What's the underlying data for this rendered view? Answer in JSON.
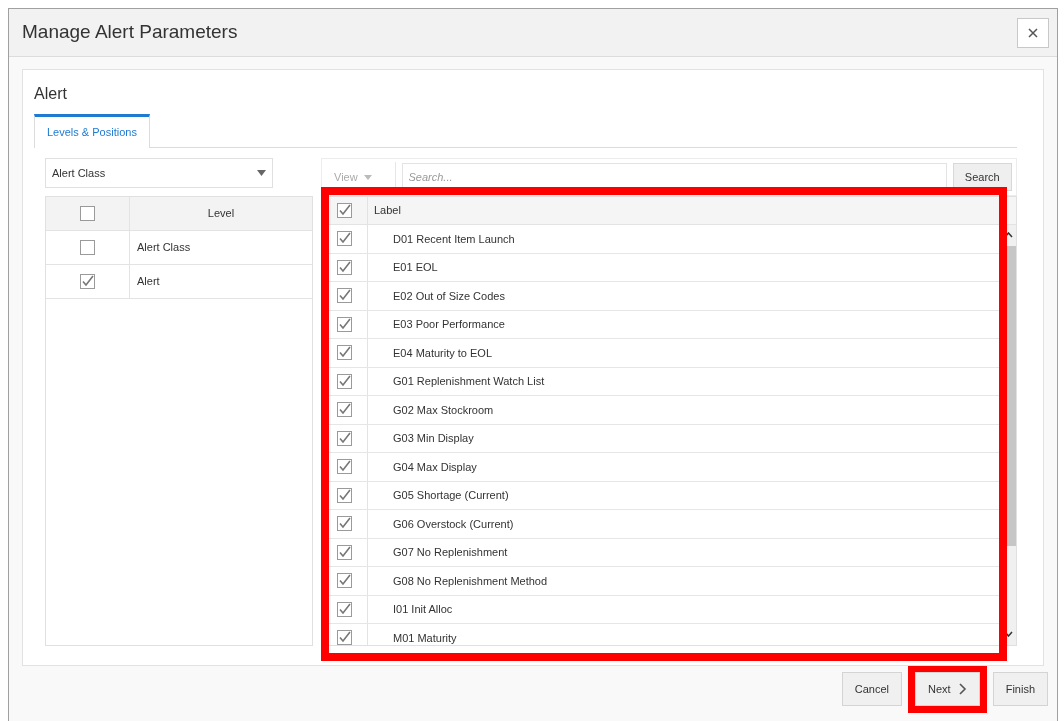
{
  "window": {
    "title": "Manage Alert Parameters"
  },
  "section_title": "Alert",
  "tabs": [
    {
      "label": "Levels & Positions",
      "selected": true
    }
  ],
  "level_select": {
    "value": "Alert Class"
  },
  "levels_table": {
    "header_checked": false,
    "column": "Level",
    "rows": [
      {
        "label": "Alert Class",
        "checked": false
      },
      {
        "label": "Alert",
        "checked": true
      }
    ]
  },
  "toolbar": {
    "view": "View",
    "search_placeholder": "Search...",
    "search_button": "Search"
  },
  "labels_table": {
    "header_checked": true,
    "column": "Label",
    "rows": [
      {
        "label": "D01 Recent Item Launch",
        "checked": true
      },
      {
        "label": "E01 EOL",
        "checked": true
      },
      {
        "label": "E02 Out of Size Codes",
        "checked": true
      },
      {
        "label": "E03 Poor Performance",
        "checked": true
      },
      {
        "label": "E04 Maturity to EOL",
        "checked": true
      },
      {
        "label": "G01 Replenishment Watch List",
        "checked": true
      },
      {
        "label": "G02 Max Stockroom",
        "checked": true
      },
      {
        "label": "G03 Min Display",
        "checked": true
      },
      {
        "label": "G04 Max Display",
        "checked": true
      },
      {
        "label": "G05 Shortage (Current)",
        "checked": true
      },
      {
        "label": "G06 Overstock (Current)",
        "checked": true
      },
      {
        "label": "G07 No Replenishment",
        "checked": true
      },
      {
        "label": "G08 No Replenishment Method",
        "checked": true
      },
      {
        "label": "I01 Init Alloc",
        "checked": true
      },
      {
        "label": "M01 Maturity",
        "checked": true
      }
    ]
  },
  "buttons": [
    {
      "label": "Cancel",
      "kind": "plain",
      "highlighted": false
    },
    {
      "label": "Next",
      "kind": "next",
      "highlighted": true
    },
    {
      "label": "Finish",
      "kind": "plain",
      "highlighted": false
    }
  ],
  "labels_table_highlighted": true
}
